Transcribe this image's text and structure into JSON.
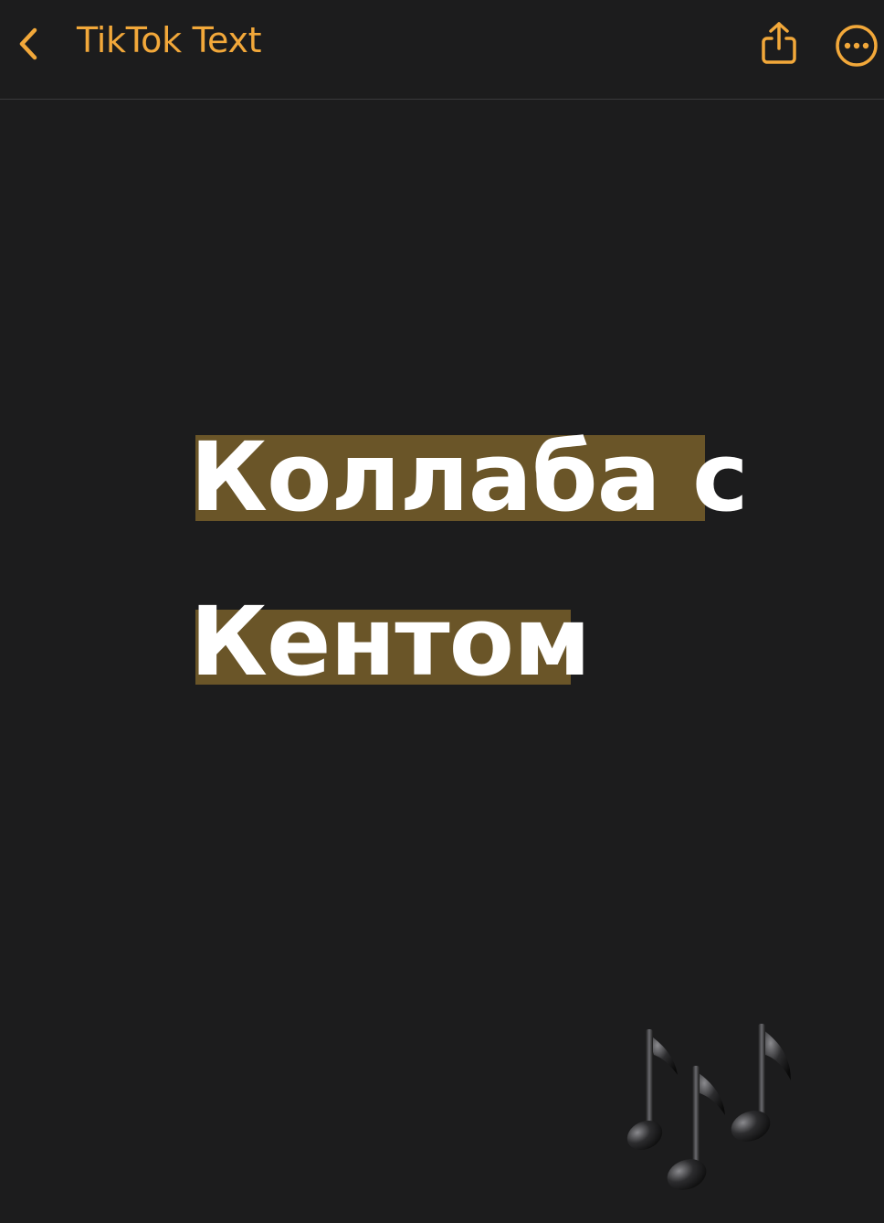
{
  "navbar": {
    "title": "TikTok Text",
    "back_icon": "chevron-left-icon",
    "share_icon": "share-icon",
    "more_icon": "ellipsis-circle-icon"
  },
  "note": {
    "lines": [
      "Коллаба с",
      "Кентом"
    ],
    "emoji": "musical-notes-icon"
  },
  "colors": {
    "accent": "#f2a83a",
    "background": "#1c1c1d",
    "highlight": "#6a5528",
    "text": "#ffffff"
  }
}
